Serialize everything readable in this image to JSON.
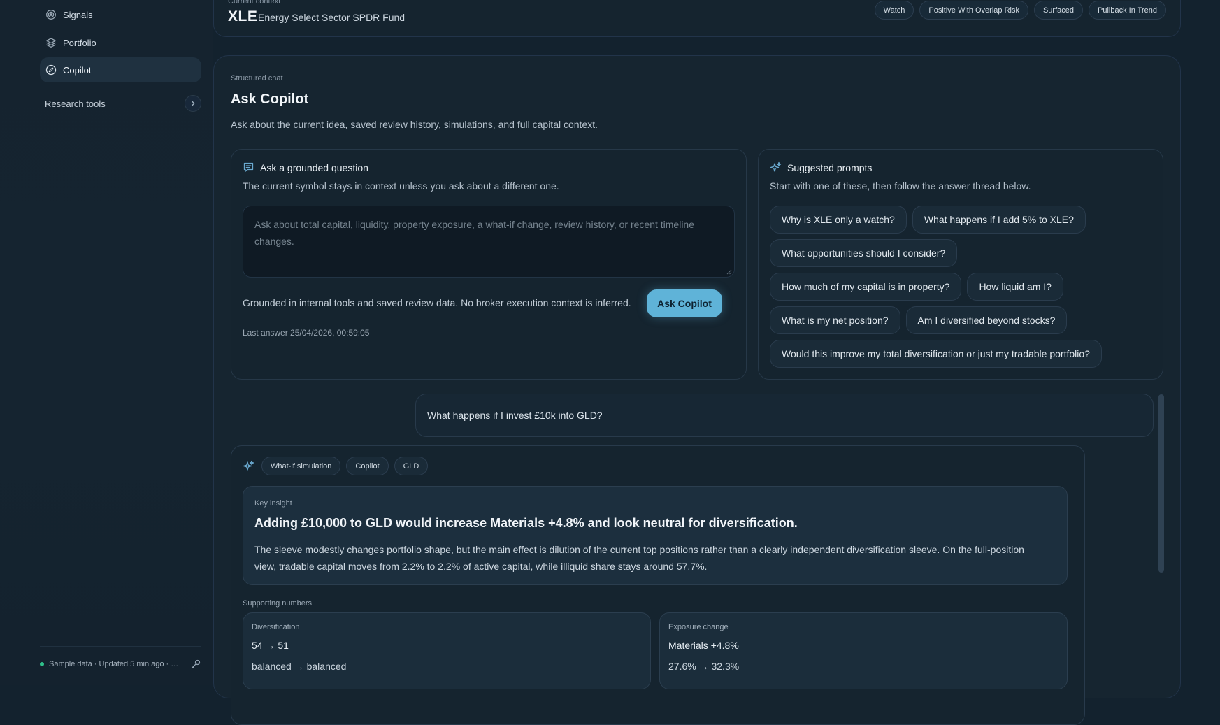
{
  "sidebar": {
    "items": [
      {
        "label": "Signals",
        "icon": "signal-icon"
      },
      {
        "label": "Portfolio",
        "icon": "layers-icon"
      },
      {
        "label": "Copilot",
        "icon": "compass-icon",
        "active": true
      }
    ],
    "research_tools_label": "Research tools",
    "footer_text": "Sample data · Updated 5 min ago · N..."
  },
  "context": {
    "label": "Current context",
    "symbol": "XLE",
    "fund_name": "Energy Select Sector SPDR Fund",
    "chips": [
      "Watch",
      "Positive With Overlap Risk",
      "Surfaced",
      "Pullback In Trend"
    ]
  },
  "main": {
    "eyebrow": "Structured chat",
    "title": "Ask Copilot",
    "subtitle": "Ask about the current idea, saved review history, simulations, and full capital context.",
    "ask": {
      "heading": "Ask a grounded question",
      "description": "The current symbol stays in context unless you ask about a different one.",
      "placeholder": "Ask about total capital, liquidity, property exposure, a what-if change, review history, or recent timeline changes.",
      "grounded_note": "Grounded in internal tools and saved review data. No broker execution context is inferred.",
      "button_label": "Ask Copilot",
      "last_answer": "Last answer 25/04/2026, 00:59:05"
    },
    "prompts": {
      "heading": "Suggested prompts",
      "description": "Start with one of these, then follow the answer thread below.",
      "items": [
        "Why is XLE only a watch?",
        "What happens if I add 5% to XLE?",
        "What opportunities should I consider?",
        "How much of my capital is in property?",
        "How liquid am I?",
        "What is my net position?",
        "Am I diversified beyond stocks?",
        "Would this improve my total diversification or just my tradable portfolio?"
      ]
    },
    "conversation": {
      "user_message": "What happens if I invest £10k into GLD?",
      "answer": {
        "tags": [
          "What-if simulation",
          "Copilot",
          "GLD"
        ],
        "insight_label": "Key insight",
        "insight_title": "Adding £10,000 to GLD would increase Materials +4.8% and look neutral for diversification.",
        "insight_body": "The sleeve modestly changes portfolio shape, but the main effect is dilution of the current top positions rather than a clearly independent diversification sleeve. On the full-position view, tradable capital moves from 2.2% to 2.2% of active capital, while illiquid share stays around 57.7%.",
        "supporting_label": "Supporting numbers",
        "metrics": [
          {
            "label": "Diversification",
            "value1": "54 → 51",
            "value2": "balanced → balanced"
          },
          {
            "label": "Exposure change",
            "value1": "Materials +4.8%",
            "value2": "27.6% → 32.3%"
          }
        ]
      }
    }
  },
  "colors": {
    "background": "#13222e",
    "accent": "#5fb3d8",
    "status_dot": "#2fbf8a"
  }
}
